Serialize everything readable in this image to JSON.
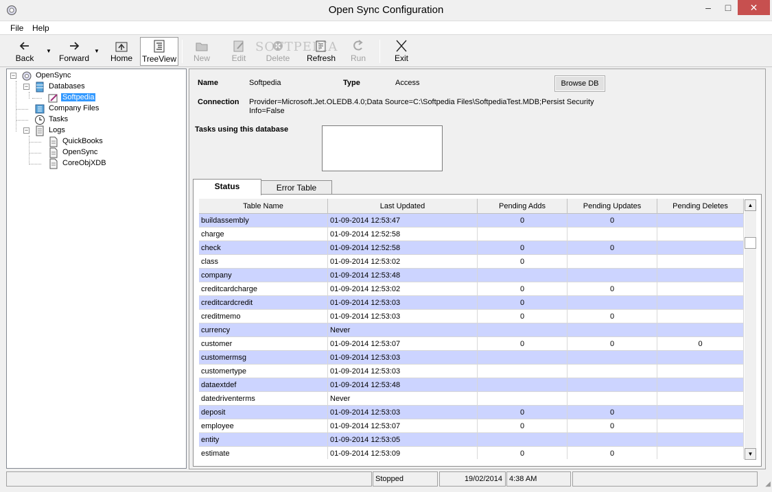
{
  "window": {
    "title": "Open Sync Configuration"
  },
  "menu": {
    "file": "File",
    "help": "Help"
  },
  "toolbar": {
    "back": "Back",
    "forward": "Forward",
    "home": "Home",
    "treeview": "TreeView",
    "new": "New",
    "edit": "Edit",
    "delete": "Delete",
    "refresh": "Refresh",
    "run": "Run",
    "exit": "Exit",
    "watermark": "SOFTPEDIA"
  },
  "tree": {
    "root": "OpenSync",
    "databases": "Databases",
    "db_selected": "Softpedia",
    "company_files": "Company Files",
    "tasks": "Tasks",
    "logs": "Logs",
    "log_items": [
      "QuickBooks",
      "OpenSync",
      "CoreObjXDB"
    ]
  },
  "details": {
    "name_label": "Name",
    "name_value": "Softpedia",
    "type_label": "Type",
    "type_value": "Access",
    "browse_button": "Browse DB",
    "connection_label": "Connection",
    "connection_line1": "Provider=Microsoft.Jet.OLEDB.4.0;Data Source=C:\\Softpedia Files\\SoftpediaTest.MDB;Persist Security",
    "connection_line2": "Info=False",
    "tasks_label": "Tasks using this database"
  },
  "tabs": {
    "status": "Status",
    "error_table": "Error Table"
  },
  "grid": {
    "columns": [
      "Table Name",
      "Last Updated",
      "Pending Adds",
      "Pending Updates",
      "Pending Deletes"
    ],
    "rows": [
      [
        "buildassembly",
        "01-09-2014 12:53:47",
        "0",
        "0",
        ""
      ],
      [
        "charge",
        "01-09-2014 12:52:58",
        "",
        "",
        ""
      ],
      [
        "check",
        "01-09-2014 12:52:58",
        "0",
        "0",
        ""
      ],
      [
        "class",
        "01-09-2014 12:53:02",
        "0",
        "",
        ""
      ],
      [
        "company",
        "01-09-2014 12:53:48",
        "",
        "",
        ""
      ],
      [
        "creditcardcharge",
        "01-09-2014 12:53:02",
        "0",
        "0",
        ""
      ],
      [
        "creditcardcredit",
        "01-09-2014 12:53:03",
        "0",
        "",
        ""
      ],
      [
        "creditmemo",
        "01-09-2014 12:53:03",
        "0",
        "0",
        ""
      ],
      [
        "currency",
        "Never",
        "",
        "",
        ""
      ],
      [
        "customer",
        "01-09-2014 12:53:07",
        "0",
        "0",
        "0"
      ],
      [
        "customermsg",
        "01-09-2014 12:53:03",
        "",
        "",
        ""
      ],
      [
        "customertype",
        "01-09-2014 12:53:03",
        "",
        "",
        ""
      ],
      [
        "dataextdef",
        "01-09-2014 12:53:48",
        "",
        "",
        ""
      ],
      [
        "datedriventerms",
        "Never",
        "",
        "",
        ""
      ],
      [
        "deposit",
        "01-09-2014 12:53:03",
        "0",
        "0",
        ""
      ],
      [
        "employee",
        "01-09-2014 12:53:07",
        "0",
        "0",
        ""
      ],
      [
        "entity",
        "01-09-2014 12:53:05",
        "",
        "",
        ""
      ],
      [
        "estimate",
        "01-09-2014 12:53:09",
        "0",
        "0",
        ""
      ]
    ]
  },
  "status": {
    "state": "Stopped",
    "date": "19/02/2014",
    "time": "4:38 AM"
  }
}
